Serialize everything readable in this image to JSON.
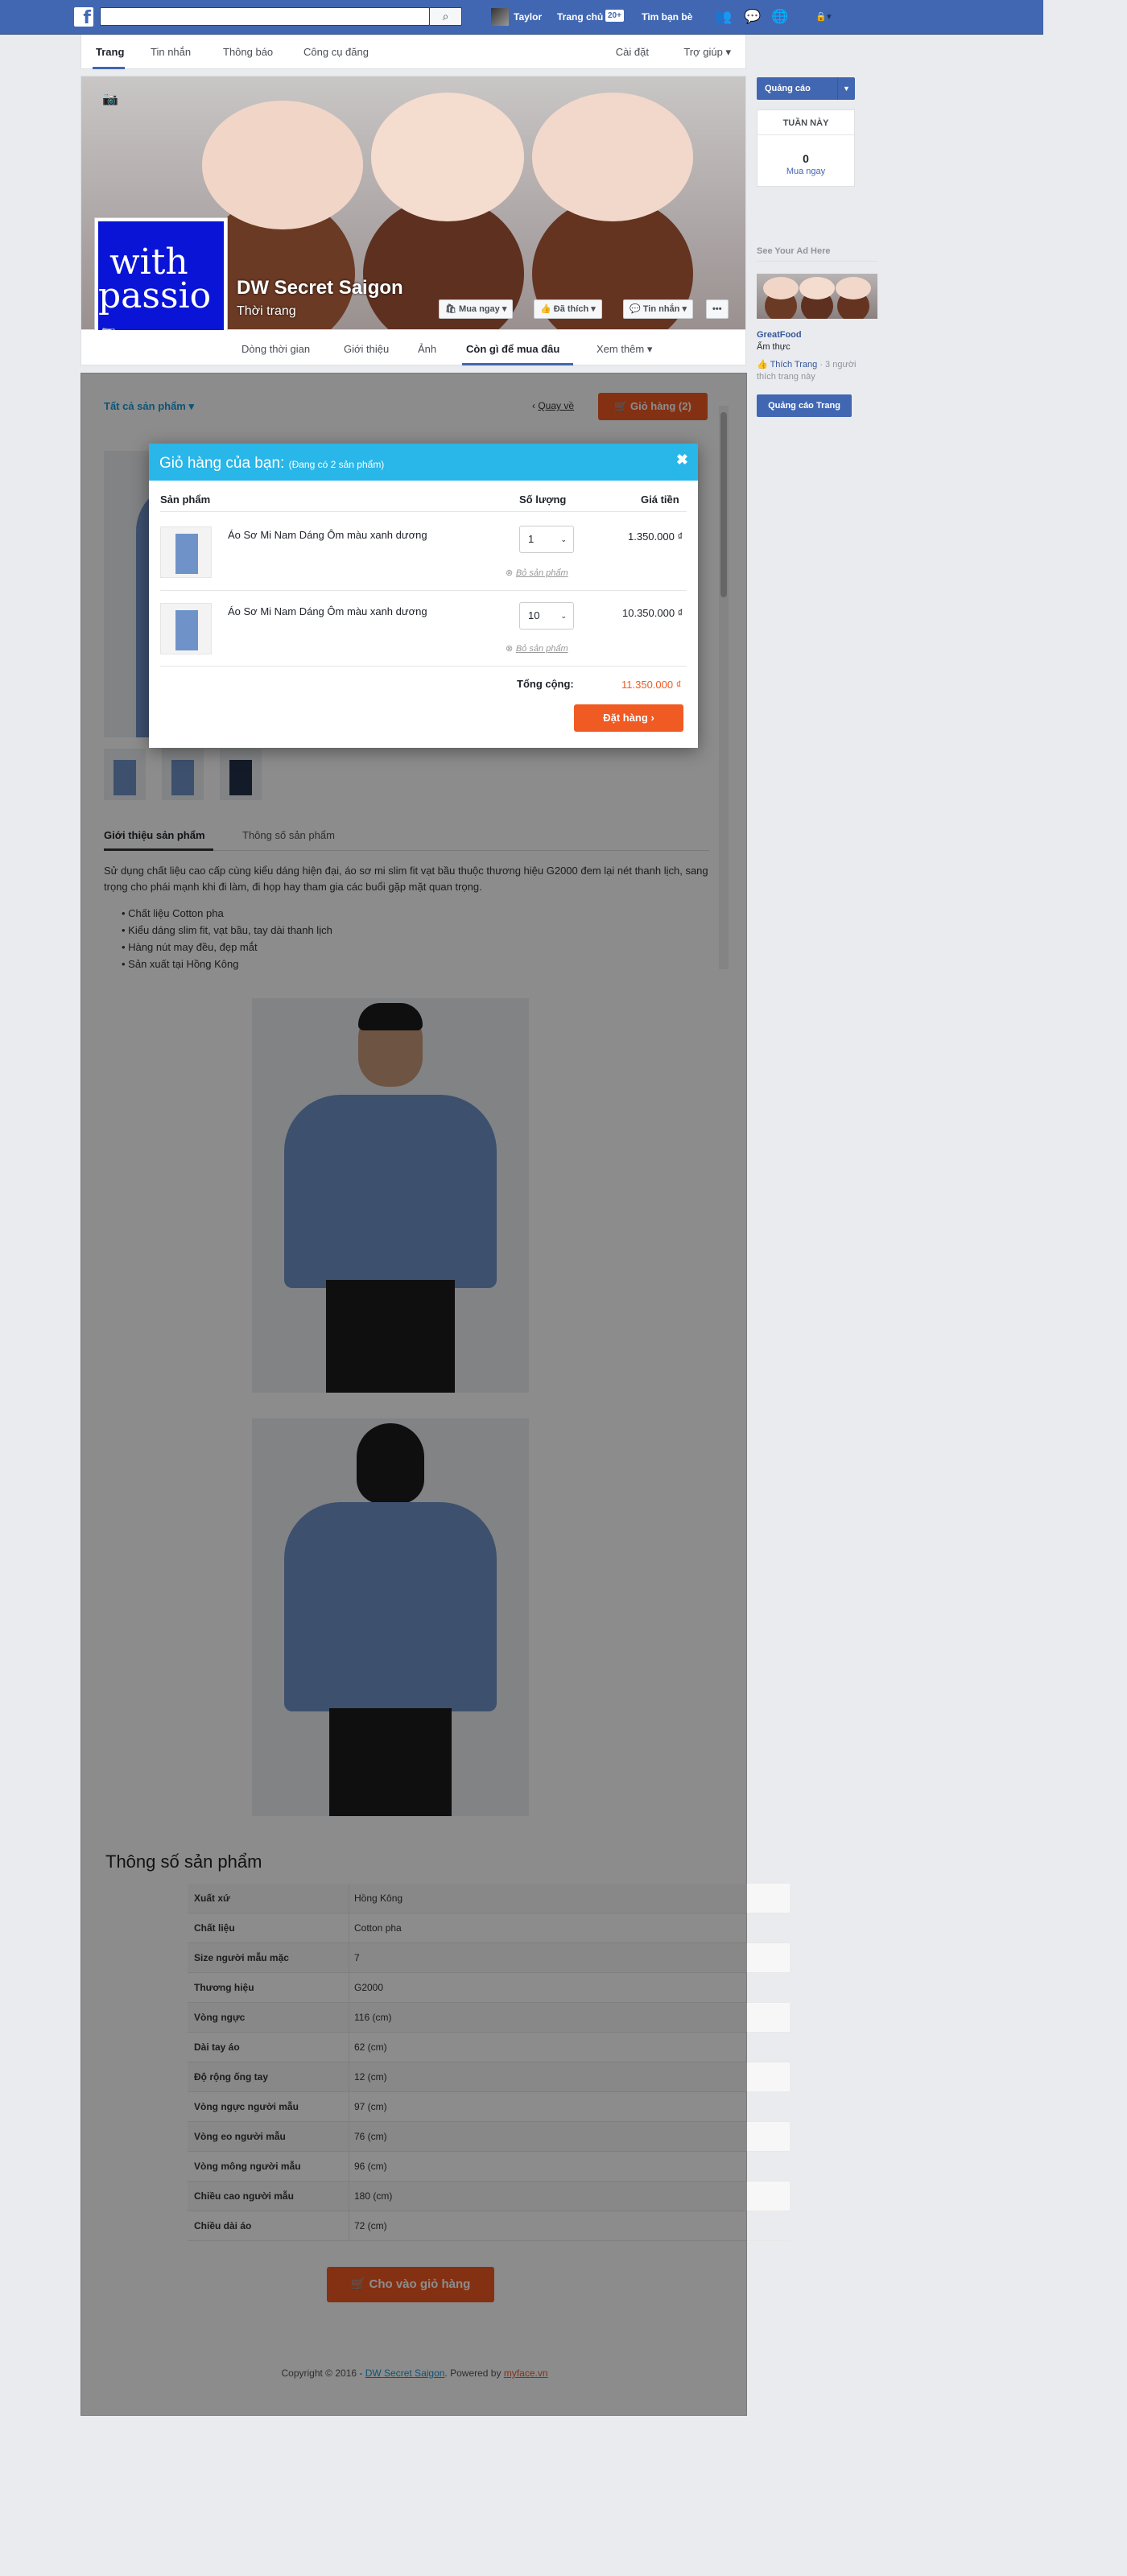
{
  "topbar": {
    "user": "Taylor",
    "home": "Trang chủ",
    "home_count": "20+",
    "find_friends": "Tìm bạn bè"
  },
  "navbar": {
    "tabs": [
      "Trang",
      "Tin nhắn",
      "Thông báo",
      "Công cụ đăng"
    ],
    "settings": "Cài đặt",
    "help": "Trợ giúp"
  },
  "page": {
    "name": "DW Secret Saigon",
    "category": "Thời trang",
    "profile_text": "with\npassio",
    "buttons": {
      "shop": "Mua ngay",
      "liked": "Đã thích",
      "message": "Tin nhắn",
      "more": "•••"
    },
    "tabs": [
      "Dòng thời gian",
      "Giới thiệu",
      "Ảnh",
      "Còn gì để mua đâu",
      "Xem thêm"
    ]
  },
  "shop": {
    "all_products": "Tất cả sản phẩm",
    "back": "Quay về",
    "cart_btn": "Giỏ hàng (2)",
    "tabs": [
      "Giới thiệu sản phẩm",
      "Thông số sản phẩm"
    ],
    "description": "Sử dụng chất liệu cao cấp cùng kiểu dáng hiện đại, áo sơ mi slim fit vạt bầu thuộc thương hiệu G2000 đem lại nét thanh lịch, sang trọng cho phái mạnh khi đi làm, đi họp hay tham gia các buổi gặp mặt quan trọng.",
    "bullets": [
      "Chất liệu Cotton pha",
      "Kiểu dáng slim fit, vạt bầu, tay dài thanh lịch",
      "Hàng nút may đều, đẹp mắt",
      "Sản xuất tại Hồng Kông"
    ],
    "spec_title": "Thông số sản phẩm",
    "specs": [
      {
        "k": "Xuất xứ",
        "v": "Hồng Kông"
      },
      {
        "k": "Chất liệu",
        "v": "Cotton pha"
      },
      {
        "k": "Size người mẫu mặc",
        "v": "7"
      },
      {
        "k": "Thương hiệu",
        "v": "G2000"
      },
      {
        "k": "Vòng ngực",
        "v": "116 (cm)"
      },
      {
        "k": "Dài tay áo",
        "v": "62 (cm)"
      },
      {
        "k": "Độ rộng ống tay",
        "v": "12 (cm)"
      },
      {
        "k": "Vòng ngực người mẫu",
        "v": "97 (cm)"
      },
      {
        "k": "Vòng eo người mẫu",
        "v": "76 (cm)"
      },
      {
        "k": "Vòng mông người mẫu",
        "v": "96 (cm)"
      },
      {
        "k": "Chiều cao người mẫu",
        "v": "180 (cm)"
      },
      {
        "k": "Chiều dài áo",
        "v": "72 (cm)"
      }
    ],
    "add_to_cart": "Cho vào giỏ hàng",
    "footer_prefix": "Copyright © 2016 - ",
    "footer_link": "DW Secret Saigon",
    "footer_mid": ". Powered by ",
    "footer_link2": "myface.vn"
  },
  "cart": {
    "title": "Giỏ hàng của bạn:",
    "subtitle": "(Đang có 2 sản phẩm)",
    "col_product": "Sản phẩm",
    "col_qty": "Số lượng",
    "col_price": "Giá tiền",
    "items": [
      {
        "name": "Áo Sơ Mi Nam Dáng Ôm màu xanh dương",
        "qty": "1",
        "price": "1.350.000 ₫",
        "remove": "Bỏ sản phẩm"
      },
      {
        "name": "Áo Sơ Mi Nam Dáng Ôm màu xanh dương",
        "qty": "10",
        "price": "10.350.000 ₫",
        "remove": "Bỏ sản phẩm"
      }
    ],
    "total_label": "Tổng cộng:",
    "total_value": "11.350.000 ₫",
    "order_btn": "Đặt hàng"
  },
  "sidebar": {
    "ads_btn": "Quảng cáo",
    "week_title": "TUẦN NÀY",
    "week_count": "0",
    "week_label": "Mua ngay",
    "ad_heading": "See Your Ad Here",
    "ad_name": "GreatFood",
    "ad_cat": "Ẩm thực",
    "ad_like": "Thích Trang",
    "ad_like_meta": "· 3 người thích trang này",
    "promote_btn": "Quảng cáo Trang"
  },
  "colors": {
    "brand": "#4267b2",
    "accent": "#f05a23",
    "modal_head": "#29b6e8",
    "link": "#1a9ad6"
  }
}
